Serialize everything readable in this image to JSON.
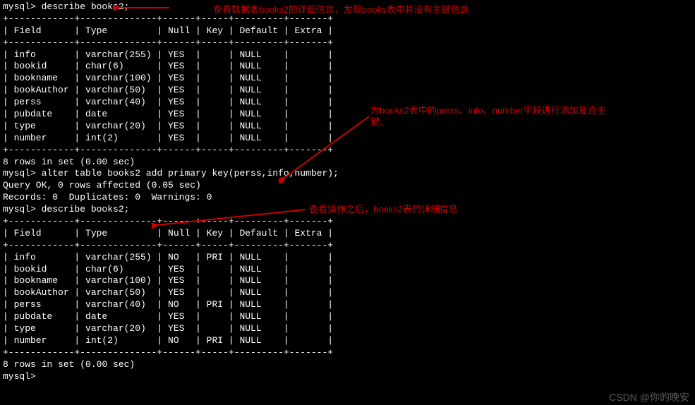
{
  "term": {
    "prompt": "mysql>",
    "cmd1": " describe books2;",
    "tableSep": "+------------+--------------+------+-----+---------+-------+",
    "headerRow": "| Field      | Type         | Null | Key | Default | Extra |",
    "t1": {
      "rows": [
        "| info       | varchar(255) | YES  |     | NULL    |       |",
        "| bookid     | char(6)      | YES  |     | NULL    |       |",
        "| bookname   | varchar(100) | YES  |     | NULL    |       |",
        "| bookAuthor | varchar(50)  | YES  |     | NULL    |       |",
        "| perss      | varchar(40)  | YES  |     | NULL    |       |",
        "| pubdate    | date         | YES  |     | NULL    |       |",
        "| type       | varchar(20)  | YES  |     | NULL    |       |",
        "| number     | int(2)       | YES  |     | NULL    |       |"
      ]
    },
    "rowsMsg": "8 rows in set (0.00 sec)",
    "blank": "",
    "cmd2": " alter table books2 add primary key(perss,info,number);",
    "queryOk": "Query OK, 0 rows affected (0.05 sec)",
    "records": "Records: 0  Duplicates: 0  Warnings: 0",
    "cmd3": " describe books2;",
    "t2": {
      "rows": [
        "| info       | varchar(255) | NO   | PRI | NULL    |       |",
        "| bookid     | char(6)      | YES  |     | NULL    |       |",
        "| bookname   | varchar(100) | YES  |     | NULL    |       |",
        "| bookAuthor | varchar(50)  | YES  |     | NULL    |       |",
        "| perss      | varchar(40)  | NO   | PRI | NULL    |       |",
        "| pubdate    | date         | YES  |     | NULL    |       |",
        "| type       | varchar(20)  | YES  |     | NULL    |       |",
        "| number     | int(2)       | NO   | PRI | NULL    |       |"
      ]
    }
  },
  "annotations": {
    "a1": "查看数据表books2的详细信息，发现books表中并没有主键信息",
    "a2line1": "为books2表中的perss，info，number字段进行添加复合主",
    "a2line2": "键。",
    "a3": "查看操作之后，books2表的详细信息"
  },
  "watermark": "CSDN @你的晚安"
}
